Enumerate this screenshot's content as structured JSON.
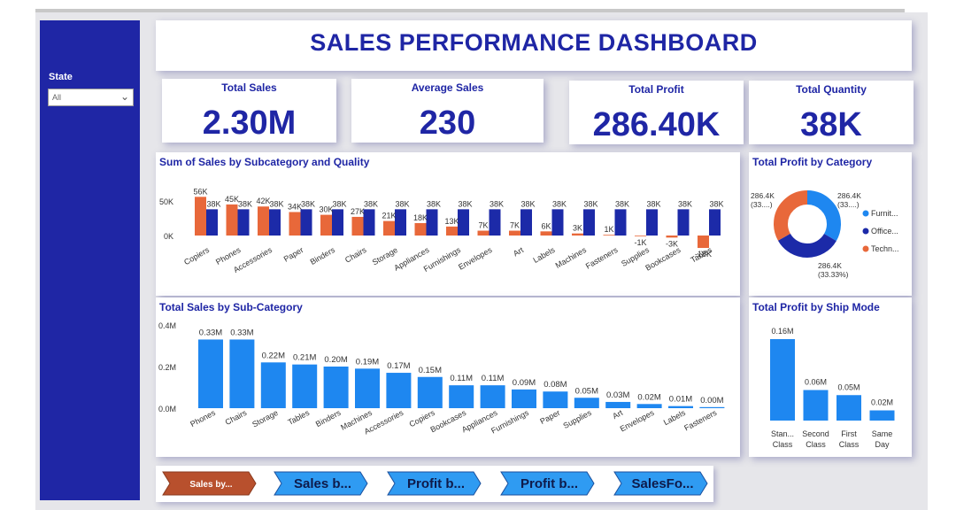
{
  "dashboard": {
    "title": "SALES PERFORMANCE DASHBOARD"
  },
  "filter": {
    "label": "State",
    "value": "All"
  },
  "kpis": {
    "total_sales": {
      "label": "Total Sales",
      "value": "2.30M"
    },
    "average_sales": {
      "label": "Average Sales",
      "value": "230"
    },
    "total_profit": {
      "label": "Total Profit",
      "value": "286.40K"
    },
    "total_quantity": {
      "label": "Total Quantity",
      "value": "38K"
    }
  },
  "nav": {
    "buttons": [
      "Sales by...",
      "Sales b...",
      "Profit b...",
      "Profit b...",
      "SalesFo..."
    ]
  },
  "colors": {
    "brand": "#1f26a5",
    "orange": "#e8683a",
    "navy": "#1c2aa8",
    "blue": "#1e87f0"
  },
  "chart_data": [
    {
      "type": "bar",
      "title": "Sum of Sales by Subcategory and Quality",
      "categories": [
        "Copiers",
        "Phones",
        "Accessories",
        "Paper",
        "Binders",
        "Chairs",
        "Storage",
        "Appliances",
        "Furnishings",
        "Envelopes",
        "Art",
        "Labels",
        "Machines",
        "Fasteners",
        "Supplies",
        "Bookcases",
        "Tables"
      ],
      "series": [
        {
          "values": [
            56,
            45,
            42,
            34,
            30,
            27,
            21,
            18,
            13,
            7,
            7,
            6,
            3,
            1,
            -1,
            -3,
            -18
          ],
          "labels": [
            "56K",
            "45K",
            "42K",
            "34K",
            "30K",
            "27K",
            "21K",
            "18K",
            "13K",
            "7K",
            "7K",
            "6K",
            "3K",
            "1K",
            "-1K",
            "-3K",
            "-18K"
          ]
        },
        {
          "values": [
            38,
            38,
            38,
            38,
            38,
            38,
            38,
            38,
            38,
            38,
            38,
            38,
            38,
            38,
            38,
            38,
            38
          ],
          "labels": [
            "38K",
            "38K",
            "38K",
            "38K",
            "38K",
            "38K",
            "38K",
            "38K",
            "38K",
            "38K",
            "38K",
            "38K",
            "38K",
            "38K",
            "38K",
            "38K",
            "38K"
          ]
        }
      ],
      "yticks": [
        "0K",
        "50K"
      ],
      "ylim": [
        -20,
        60
      ]
    },
    {
      "type": "pie",
      "title": "Total Profit by Category",
      "slices": [
        {
          "name": "Furnit...",
          "value": 286.4,
          "label": "286.4K\n(33....)"
        },
        {
          "name": "Office...",
          "value": 286.4,
          "label": "286.4K\n(33.33%)"
        },
        {
          "name": "Techn...",
          "value": 286.4,
          "label": "286.4K\n(33....)"
        }
      ]
    },
    {
      "type": "bar",
      "title": "Total Sales by Sub-Category",
      "categories": [
        "Phones",
        "Chairs",
        "Storage",
        "Tables",
        "Binders",
        "Machines",
        "Accessories",
        "Copiers",
        "Bookcases",
        "Appliances",
        "Furnishings",
        "Paper",
        "Supplies",
        "Art",
        "Envelopes",
        "Labels",
        "Fasteners"
      ],
      "values": [
        0.33,
        0.33,
        0.22,
        0.21,
        0.2,
        0.19,
        0.17,
        0.15,
        0.11,
        0.11,
        0.09,
        0.08,
        0.05,
        0.03,
        0.02,
        0.01,
        0.0
      ],
      "labels": [
        "0.33M",
        "0.33M",
        "0.22M",
        "0.21M",
        "0.20M",
        "0.19M",
        "0.17M",
        "0.15M",
        "0.11M",
        "0.11M",
        "0.09M",
        "0.08M",
        "0.05M",
        "0.03M",
        "0.02M",
        "0.01M",
        "0.00M"
      ],
      "yticks": [
        "0.0M",
        "0.2M",
        "0.4M"
      ],
      "ylim": [
        0,
        0.4
      ]
    },
    {
      "type": "bar",
      "title": "Total Profit by Ship Mode",
      "categories": [
        "Stan... Class",
        "Second Class",
        "First Class",
        "Same Day"
      ],
      "values": [
        0.16,
        0.06,
        0.05,
        0.02
      ],
      "labels": [
        "0.16M",
        "0.06M",
        "0.05M",
        "0.02M"
      ]
    }
  ]
}
